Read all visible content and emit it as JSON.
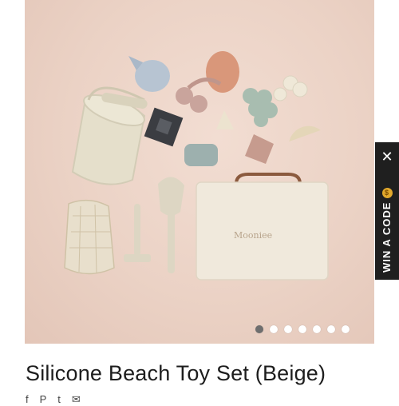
{
  "product": {
    "title": "Silicone Beach Toy Set (Beige)",
    "brand_on_case": "Mooniee",
    "image_alt": "Silicone beach toys with bucket, net bag and storage case"
  },
  "carousel": {
    "slide_count": 7,
    "active_index": 0
  },
  "promo_tab": {
    "label": "WIN A CODE",
    "close_icon": "close-icon",
    "coin_icon": "coin-icon"
  },
  "share_icons": [
    "facebook-icon",
    "pinterest-icon",
    "twitter-icon",
    "email-icon"
  ],
  "colors": {
    "background": "#ebd2c5",
    "promo_tab": "#1f1f1f",
    "active_dot": "#6e6e6e",
    "title_text": "#1d1d1d"
  }
}
